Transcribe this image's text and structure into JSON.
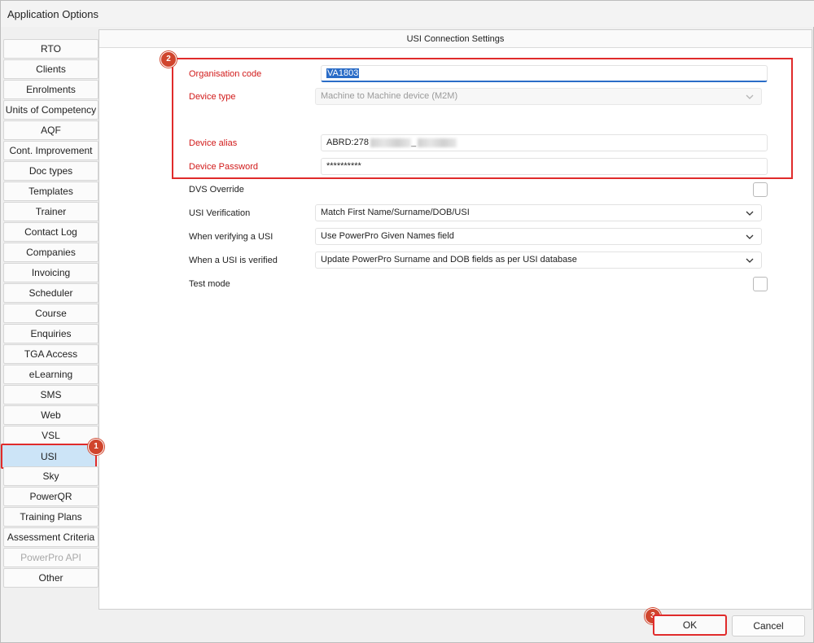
{
  "window": {
    "title": "Application Options"
  },
  "sidebar": {
    "items": [
      {
        "label": "RTO"
      },
      {
        "label": "Clients"
      },
      {
        "label": "Enrolments"
      },
      {
        "label": "Units of Competency"
      },
      {
        "label": "AQF"
      },
      {
        "label": "Cont. Improvement"
      },
      {
        "label": "Doc types"
      },
      {
        "label": "Templates"
      },
      {
        "label": "Trainer"
      },
      {
        "label": "Contact Log"
      },
      {
        "label": "Companies"
      },
      {
        "label": "Invoicing"
      },
      {
        "label": "Scheduler"
      },
      {
        "label": "Course"
      },
      {
        "label": "Enquiries"
      },
      {
        "label": "TGA Access"
      },
      {
        "label": "eLearning"
      },
      {
        "label": "SMS"
      },
      {
        "label": "Web"
      },
      {
        "label": "VSL"
      },
      {
        "label": "USI",
        "state": "selected"
      },
      {
        "label": "Sky"
      },
      {
        "label": "PowerQR"
      },
      {
        "label": "Training Plans"
      },
      {
        "label": "Assessment Criteria"
      },
      {
        "label": "PowerPro API",
        "state": "disabled"
      },
      {
        "label": "Other"
      }
    ]
  },
  "panel": {
    "header": "USI Connection Settings",
    "org_code": {
      "label": "Organisation code",
      "value": "VA1803"
    },
    "device_type": {
      "label": "Device type",
      "value": "Machine to Machine device (M2M)"
    },
    "device_alias": {
      "label": "Device alias",
      "value": "ABRD:278"
    },
    "device_password": {
      "label": "Device Password",
      "value": "**********"
    },
    "dvs_override": {
      "label": "DVS Override",
      "checked": false
    },
    "usi_verification": {
      "label": "USI Verification",
      "value": "Match First Name/Surname/DOB/USI"
    },
    "verifying_usi": {
      "label": "When verifying a USI",
      "value": "Use PowerPro Given Names field"
    },
    "usi_verified": {
      "label": "When a USI is verified",
      "value": "Update PowerPro Surname and DOB fields as per USI database"
    },
    "test_mode": {
      "label": "Test mode",
      "checked": false
    }
  },
  "footer": {
    "ok_label": "OK",
    "cancel_label": "Cancel"
  },
  "annotations": {
    "badge1": "1",
    "badge2": "2",
    "badge3": "3"
  },
  "colors": {
    "highlight_red": "#e02b2b",
    "badge": "#d0452d",
    "required_label": "#d11a1a",
    "selection_blue": "#cce4f7"
  }
}
